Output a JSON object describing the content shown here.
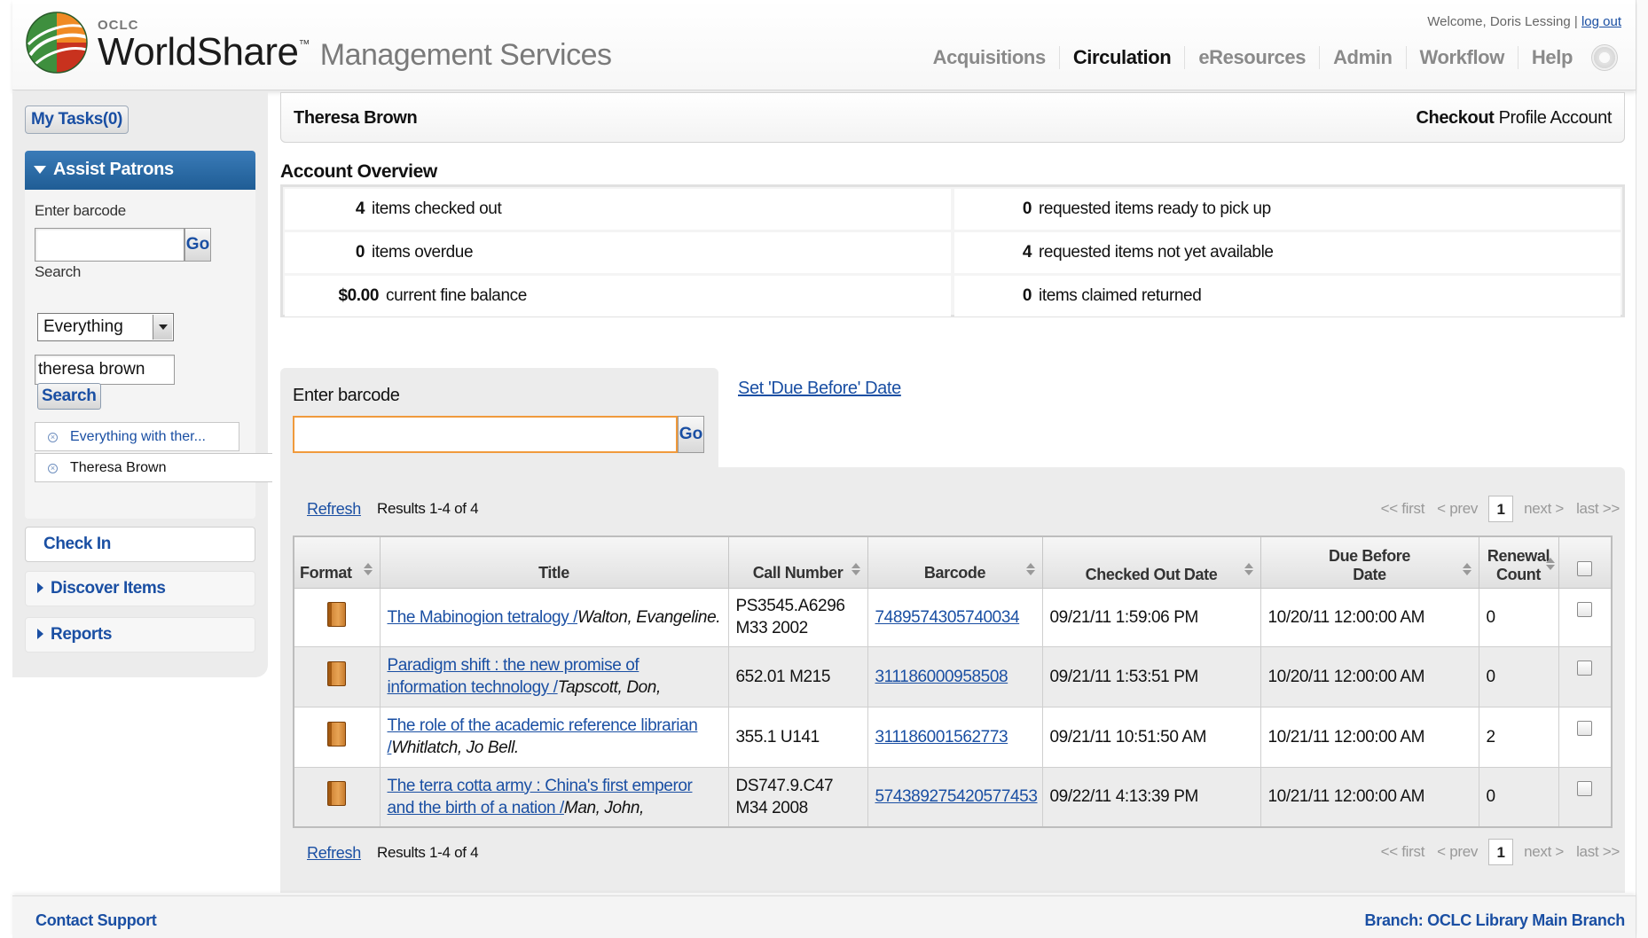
{
  "header": {
    "brand_oclc": "OCLC",
    "brand_main": "WorldShare",
    "brand_tm": "™",
    "brand_sub": "Management Services",
    "welcome": "Welcome, Doris Lessing |",
    "logout": "log out",
    "nav": [
      "Acquisitions",
      "Circulation",
      "eResources",
      "Admin",
      "Workflow",
      "Help"
    ],
    "active_nav": "Circulation"
  },
  "sidebar": {
    "my_tasks": "My Tasks(0)",
    "assist_title": "Assist Patrons",
    "barcode_label": "Enter barcode",
    "barcode_value": "",
    "go": "Go",
    "search_label": "Search",
    "search_scope": "Everything",
    "search_value": "theresa brown",
    "search_button": "Search",
    "crumbs": [
      "Everything with ther...",
      "Theresa Brown"
    ],
    "check_in": "Check In",
    "discover": "Discover Items",
    "reports": "Reports"
  },
  "patron": {
    "name": "Theresa Brown",
    "tab_active": "Checkout",
    "tab_rest": "Profile Account"
  },
  "overview": {
    "title": "Account Overview",
    "left": [
      {
        "value": "4",
        "label": "items checked out"
      },
      {
        "value": "0",
        "label": "items overdue"
      },
      {
        "value": "$0.00",
        "label": "current fine balance"
      }
    ],
    "right": [
      {
        "value": "0",
        "label": "requested items ready to pick up"
      },
      {
        "value": "4",
        "label": "requested items not yet available"
      },
      {
        "value": "0",
        "label": "items claimed returned"
      }
    ]
  },
  "checkout": {
    "barcode_label": "Enter barcode",
    "go": "Go",
    "due_before_link": "Set 'Due Before' Date"
  },
  "results": {
    "refresh": "Refresh",
    "summary": "Results 1-4 of 4",
    "pager": {
      "first": "<< first",
      "prev": "< prev",
      "page": "1",
      "next": "next >",
      "last": "last >>"
    },
    "columns": [
      "Format",
      "Title",
      "Call Number",
      "Barcode",
      "Checked Out Date",
      "Due Before Date",
      "Renewal Count"
    ],
    "rows": [
      {
        "format_icon": "book-icon",
        "title": "The Mabinogion tetralogy /",
        "author": "Walton, Evangeline.",
        "call_number": "PS3545.A6296 M33 2002",
        "barcode": "7489574305740034",
        "checked_out": "09/21/11 1:59:06 PM",
        "due": "10/20/11 12:00:00 AM",
        "renewals": "0"
      },
      {
        "format_icon": "book-icon",
        "title": "Paradigm shift : the new promise of information technology /",
        "author": "Tapscott, Don,",
        "call_number": "652.01 M215",
        "barcode": "311186000958508",
        "checked_out": "09/21/11 1:53:51 PM",
        "due": "10/20/11 12:00:00 AM",
        "renewals": "0"
      },
      {
        "format_icon": "book-icon",
        "title": "The role of the academic reference librarian /",
        "author": "Whitlatch, Jo Bell.",
        "call_number": "355.1 U141",
        "barcode": "311186001562773",
        "checked_out": "09/21/11 10:51:50 AM",
        "due": "10/21/11 12:00:00 AM",
        "renewals": "2"
      },
      {
        "format_icon": "book-icon",
        "title": "The terra cotta army : China's first emperor and the birth of a nation /",
        "author": "Man, John,",
        "call_number": "DS747.9.C47 M34 2008",
        "barcode": "574389275420577453",
        "checked_out": "09/22/11 4:13:39 PM",
        "due": "10/21/11 12:00:00 AM",
        "renewals": "0"
      }
    ]
  },
  "footer": {
    "contact": "Contact Support",
    "branch": "Branch: OCLC Library Main Branch"
  },
  "colors": {
    "link": "#1a4fa3",
    "accent_header": "#2d6ea8",
    "input_focus": "#f09a3c"
  }
}
